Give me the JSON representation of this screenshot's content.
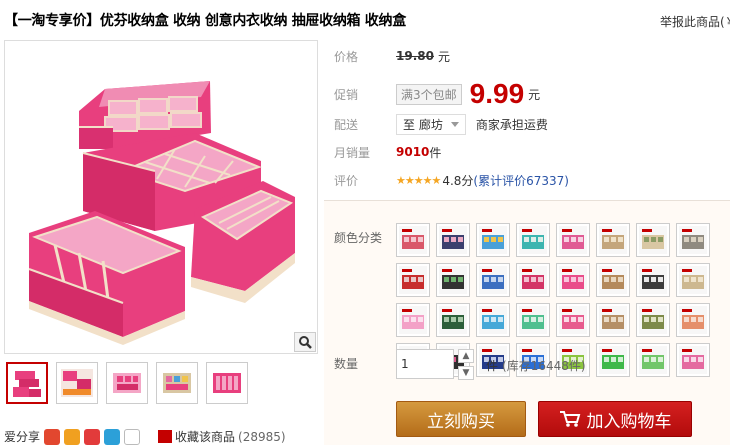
{
  "product": {
    "title": "【一淘专享价】优芬收纳盒 收纳 创意内衣收纳 抽屉收纳箱 收纳盒",
    "report_label": "举报此商品(￥"
  },
  "pricing": {
    "price_label": "价格",
    "original_price": "19.80",
    "currency_unit": "元",
    "promo_label": "促销",
    "promo_badge": "满3个包邮",
    "promo_price": "9.99",
    "promo_unit": "元"
  },
  "delivery": {
    "label": "配送",
    "destination": "至 廊坊",
    "note": "商家承担运费"
  },
  "sales": {
    "label": "月销量",
    "count": "9010",
    "unit": "件"
  },
  "review": {
    "label": "评价",
    "stars": "★★★★★",
    "score": "4.8分",
    "count_text": "(累计评价67337)"
  },
  "sku": {
    "color_label": "颜色分类",
    "swatches": [
      {
        "name": "red-white",
        "colors": [
          "#d9586a",
          "#f3c7cf"
        ]
      },
      {
        "name": "navy-floral",
        "colors": [
          "#3b3f6e",
          "#e9a9c3"
        ]
      },
      {
        "name": "blue-cartoon",
        "colors": [
          "#4aa0d8",
          "#f0c44c"
        ]
      },
      {
        "name": "teal",
        "colors": [
          "#3db5b0",
          "#dfeee8"
        ]
      },
      {
        "name": "pink-dot",
        "colors": [
          "#e05a94",
          "#f6d3e3"
        ]
      },
      {
        "name": "beige-pattern",
        "colors": [
          "#c4a67c",
          "#efe2c9"
        ]
      },
      {
        "name": "cream-print",
        "colors": [
          "#d9c7a3",
          "#8a9b64"
        ]
      },
      {
        "name": "grey-khaki",
        "colors": [
          "#8f8a80",
          "#d8d0c0"
        ]
      },
      {
        "name": "red-box",
        "colors": [
          "#c72d2d",
          "#e8c7c7"
        ]
      },
      {
        "name": "black-stripe",
        "colors": [
          "#333333",
          "#6fb36f"
        ]
      },
      {
        "name": "blue-box",
        "colors": [
          "#3c6fc0",
          "#c6d6ee"
        ]
      },
      {
        "name": "rose-red",
        "colors": [
          "#d33466",
          "#f2c0d0"
        ]
      },
      {
        "name": "hot-pink",
        "colors": [
          "#e94c8a",
          "#f7c6dc"
        ]
      },
      {
        "name": "khaki-brown",
        "colors": [
          "#b48a5c",
          "#e8d7bf"
        ]
      },
      {
        "name": "cow-print",
        "colors": [
          "#3d3d3d",
          "#e8e8e8"
        ]
      },
      {
        "name": "beige",
        "colors": [
          "#cdb890",
          "#efe4cd"
        ]
      },
      {
        "name": "light-pink",
        "colors": [
          "#f3a1c7",
          "#fbe1ee"
        ]
      },
      {
        "name": "dark-green",
        "colors": [
          "#2c5f3a",
          "#a8c9a9"
        ]
      },
      {
        "name": "cyan",
        "colors": [
          "#46a8d8",
          "#cfe8f4"
        ]
      },
      {
        "name": "mint",
        "colors": [
          "#4fbf8f",
          "#d8f0e3"
        ]
      },
      {
        "name": "pink-red",
        "colors": [
          "#e75b8e",
          "#fadbe7"
        ]
      },
      {
        "name": "tan",
        "colors": [
          "#b58f66",
          "#eadbc7"
        ]
      },
      {
        "name": "olive-dot",
        "colors": [
          "#7d8a4a",
          "#e0e3c5"
        ]
      },
      {
        "name": "peach",
        "colors": [
          "#e58f6b",
          "#f6dccf"
        ]
      },
      {
        "name": "black",
        "colors": [
          "#222222",
          "#777777"
        ]
      },
      {
        "name": "black-floral",
        "colors": [
          "#2f2f2f",
          "#d9588a"
        ]
      },
      {
        "name": "navy",
        "colors": [
          "#243c8a",
          "#c2cbe8"
        ]
      },
      {
        "name": "blue",
        "colors": [
          "#2a6fd6",
          "#c9dbf6"
        ]
      },
      {
        "name": "lime",
        "colors": [
          "#8ac43f",
          "#e3f2cf"
        ]
      },
      {
        "name": "green",
        "colors": [
          "#3fb84a",
          "#d2efd4"
        ]
      },
      {
        "name": "light-green",
        "colors": [
          "#72c66a",
          "#ddf2da"
        ]
      },
      {
        "name": "pink-pattern",
        "colors": [
          "#e46aa0",
          "#f8d9e8"
        ]
      }
    ],
    "qty_label": "数量",
    "qty_value": "1",
    "stock_unit": "件",
    "stock_text": "(库存16448件)"
  },
  "actions": {
    "buy_now": "立刻购买",
    "add_to_cart": "加入购物车"
  },
  "share": {
    "label": "爱分享",
    "favorite_label": "收藏该商品",
    "favorite_count": "(28985)"
  },
  "colors": {
    "accent_red": "#c40000",
    "link_blue": "#2953a6",
    "buy_orange": "#c47f2a",
    "cart_red": "#c41212"
  }
}
